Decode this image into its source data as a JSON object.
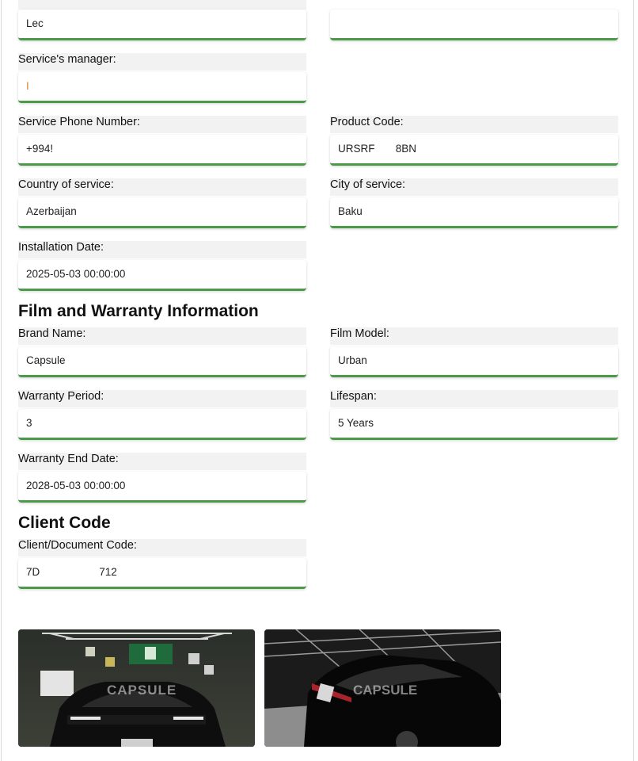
{
  "service": {
    "top_left_value": "Lec",
    "top_right_value": "",
    "manager_label": "Service's manager:",
    "manager_value": "I",
    "phone_label": "Service Phone Number:",
    "phone_value": "+994!",
    "product_code_label": "Product Code:",
    "product_code_value": "URSRF       8BN",
    "country_label": "Country of service:",
    "country_value": "Azerbaijan",
    "city_label": "City of service:",
    "city_value": "Baku",
    "install_label": "Installation Date:",
    "install_value": "2025-05-03 00:00:00"
  },
  "film": {
    "heading": "Film and Warranty Information",
    "brand_label": "Brand Name:",
    "brand_value": "Capsule",
    "model_label": "Film Model:",
    "model_value": "Urban",
    "warranty_label": "Warranty Period:",
    "warranty_value": "3",
    "lifespan_label": "Lifespan:",
    "lifespan_value": "5 Years",
    "end_label": "Warranty End Date:",
    "end_value": "2028-05-03 00:00:00"
  },
  "client": {
    "heading": "Client Code",
    "code_label": "Client/Document Code:",
    "code_value": "7D                    712"
  },
  "photos": {
    "watermark": "CAPSULE"
  },
  "colors": {
    "accent_underline": "#4a9a4a",
    "label_bg": "#f2f2f2"
  }
}
